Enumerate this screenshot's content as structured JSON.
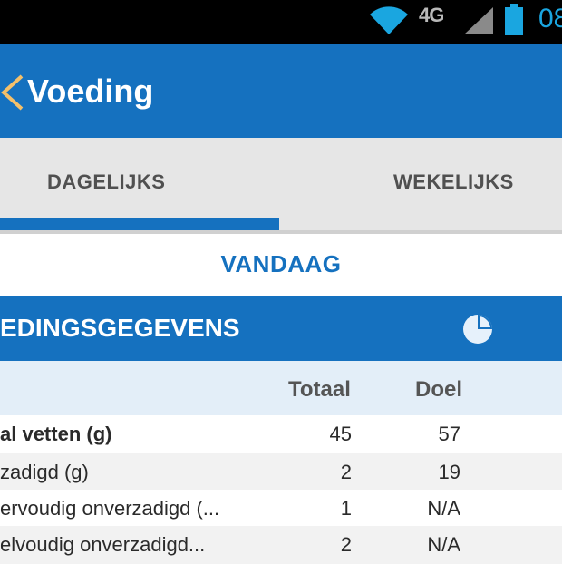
{
  "status_bar": {
    "network": "4G",
    "clock": "08",
    "icons": [
      "wifi-icon",
      "signal-icon",
      "battery-icon"
    ],
    "clock_color": "#1aa6e0"
  },
  "action_bar": {
    "title": "Voeding",
    "back_icon": "back-chevron-icon",
    "color": "#1571bf"
  },
  "tabs": [
    {
      "label": "DAGELIJKS",
      "selected": true
    },
    {
      "label": "WEKELIJKS",
      "selected": false
    }
  ],
  "date_selector": {
    "label": "VANDAAG"
  },
  "section": {
    "title": "EDINGSGEGEVENS",
    "icon": "pie-chart-icon"
  },
  "table": {
    "columns": [
      "Totaal",
      "Doel"
    ],
    "rows": [
      {
        "name": "al vetten (g)",
        "total": "45",
        "goal": "57"
      },
      {
        "name": "zadigd (g)",
        "total": "2",
        "goal": "19"
      },
      {
        "name": "ervoudig onverzadigd (...",
        "total": "1",
        "goal": "N/A"
      },
      {
        "name": "elvoudig onverzadigd...",
        "total": "2",
        "goal": "N/A"
      }
    ]
  }
}
